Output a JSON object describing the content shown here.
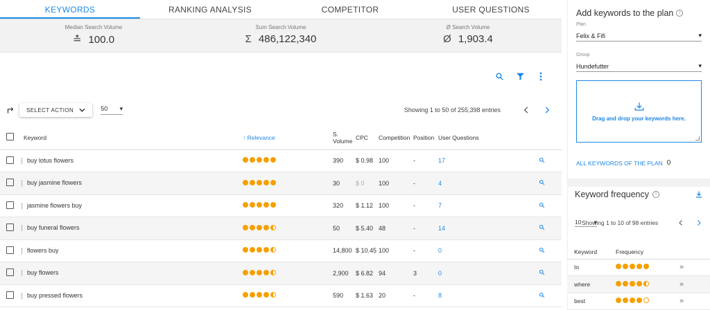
{
  "tabs": [
    {
      "label": "KEYWORDS",
      "active": true
    },
    {
      "label": "RANKING ANALYSIS",
      "active": false
    },
    {
      "label": "COMPETITOR",
      "active": false
    },
    {
      "label": "USER QUESTIONS",
      "active": false
    }
  ],
  "stats": {
    "median": {
      "label": "Median Search Volume",
      "value": "100.0",
      "symbol": "≛"
    },
    "sum": {
      "label": "Sum Search Volume",
      "value": "486,122,340",
      "symbol": "Σ"
    },
    "avg": {
      "label": "Ø Search Volume",
      "value": "1,903.4",
      "symbol": "Ø"
    }
  },
  "toolbar": {
    "select_action": "SELECT ACTION",
    "per_page": "50",
    "showing": "Showing 1 to 50 of 255,398 entries"
  },
  "table": {
    "headers": {
      "keyword": "Keyword",
      "relevance": "Relevance",
      "volume_1": "S.",
      "volume_2": "Volume",
      "cpc": "CPC",
      "competition": "Competition",
      "position": "Position",
      "questions": "User Questions"
    },
    "rows": [
      {
        "keyword": "buy lotus flowers",
        "relevance": 5,
        "volume": "390",
        "cpc": "$ 0.98",
        "competition": "100",
        "position": "-",
        "questions": "17"
      },
      {
        "keyword": "buy jasmine flowers",
        "relevance": 5,
        "volume": "30",
        "cpc": "$ 0",
        "competition": "100",
        "position": "-",
        "questions": "4"
      },
      {
        "keyword": "jasmine flowers buy",
        "relevance": 5,
        "volume": "320",
        "cpc": "$ 1.12",
        "competition": "100",
        "position": "-",
        "questions": "7"
      },
      {
        "keyword": "buy funeral flowers",
        "relevance": 4.5,
        "volume": "50",
        "cpc": "$ 5.40",
        "competition": "48",
        "position": "-",
        "questions": "14"
      },
      {
        "keyword": "flowers buy",
        "relevance": 4.5,
        "volume": "14,800",
        "cpc": "$ 10.45",
        "competition": "100",
        "position": "-",
        "questions": "0"
      },
      {
        "keyword": "buy flowers",
        "relevance": 4.5,
        "volume": "2,900",
        "cpc": "$ 6.82",
        "competition": "94",
        "position": "3",
        "questions": "0"
      },
      {
        "keyword": "buy pressed flowers",
        "relevance": 4.5,
        "volume": "590",
        "cpc": "$ 1.63",
        "competition": "20",
        "position": "-",
        "questions": "8"
      }
    ]
  },
  "side": {
    "title": "Add keywords to the plan",
    "plan_label": "Plan",
    "plan_value": "Felix & Fifi",
    "group_label": "Group",
    "group_value": "Hundefutter",
    "dropzone_text": "Drag and drop your keywords here.",
    "all_keywords_link": "ALL KEYWORDS OF THE PLAN",
    "all_keywords_count": "0"
  },
  "frequency": {
    "title": "Keyword frequency",
    "per_page": "10",
    "showing": "Showing 1 to 10 of 98 entries",
    "col_keyword": "Keyword",
    "col_frequency": "Frequency",
    "rows": [
      {
        "keyword": "to",
        "frequency": 5
      },
      {
        "keyword": "where",
        "frequency": 4.5
      },
      {
        "keyword": "best",
        "frequency": 4
      }
    ]
  },
  "colors": {
    "accent": "#1e88e5",
    "rating": "#f5a000"
  }
}
